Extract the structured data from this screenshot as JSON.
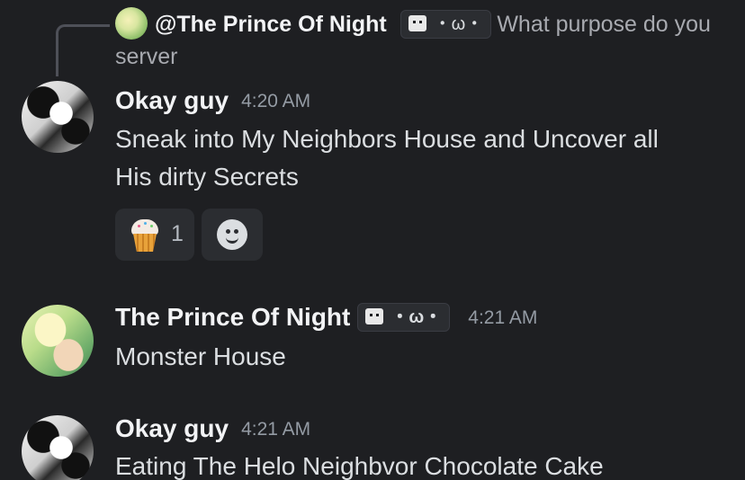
{
  "reply": {
    "mention": "@The Prince Of Night",
    "tag_text": "・ω・",
    "preview_text": "What purpose do you server",
    "avatar_icon": "avatar-prince-icon"
  },
  "messages": [
    {
      "author": "Okay guy",
      "timestamp": "4:20 AM",
      "lines": [
        "Sneak into My  Neighbors House and Uncover all",
        "His dirty Secrets"
      ],
      "avatar_icon": "avatar-okay-guy-icon",
      "reactions": [
        {
          "emoji": "cupcake-icon",
          "count": "1"
        }
      ]
    },
    {
      "author": "The Prince Of Night",
      "tag_text": "・ω・",
      "timestamp": "4:21 AM",
      "lines": [
        "Monster House"
      ],
      "avatar_icon": "avatar-prince-icon"
    },
    {
      "author": "Okay guy",
      "timestamp": "4:21 AM",
      "lines": [
        "Eating The Helo Neighbvor Chocolate Cake"
      ],
      "avatar_icon": "avatar-okay-guy-icon"
    }
  ],
  "colors": {
    "background": "#1e1f22",
    "text": "#dbdee1",
    "username": "#f2f3f5",
    "muted": "#949ba4",
    "reaction_bg": "#2b2d31"
  }
}
